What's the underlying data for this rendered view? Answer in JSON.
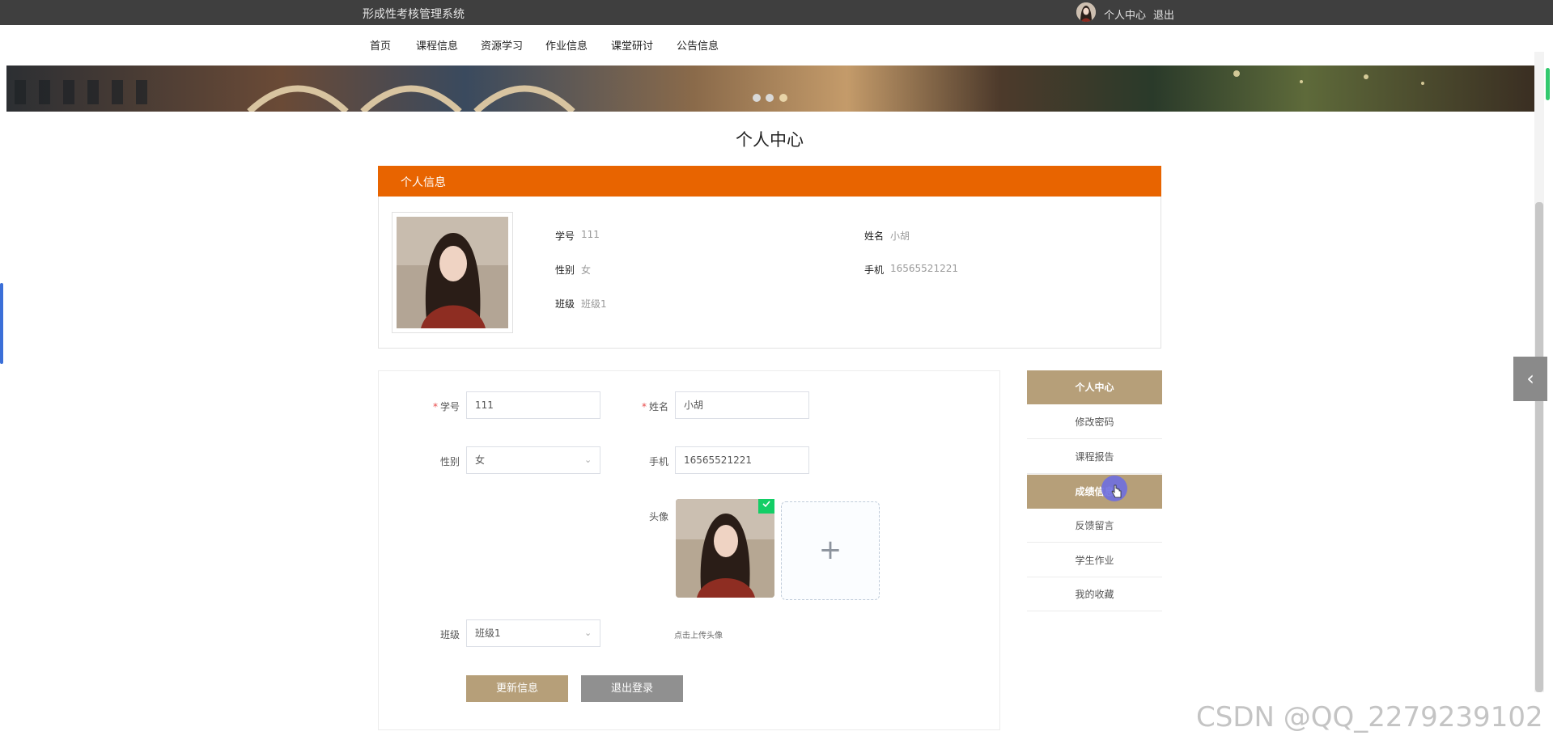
{
  "header": {
    "site_title": "形成性考核管理系统",
    "user_center": "个人中心",
    "logout": "退出"
  },
  "nav": {
    "items": [
      "首页",
      "课程信息",
      "资源学习",
      "作业信息",
      "课堂研讨",
      "公告信息"
    ]
  },
  "page": {
    "title": "个人中心"
  },
  "info_card": {
    "heading": "个人信息",
    "fields": {
      "student_id_label": "学号",
      "student_id_value": "111",
      "name_label": "姓名",
      "name_value": "小胡",
      "gender_label": "性别",
      "gender_value": "女",
      "phone_label": "手机",
      "phone_value": "16565521221",
      "class_label": "班级",
      "class_value": "班级1"
    }
  },
  "form": {
    "student_id_label": "学号",
    "student_id_value": "111",
    "name_label": "姓名",
    "name_value": "小胡",
    "gender_label": "性别",
    "gender_value": "女",
    "phone_label": "手机",
    "phone_value": "16565521221",
    "avatar_label": "头像",
    "upload_hint": "点击上传头像",
    "class_label": "班级",
    "class_value": "班级1",
    "update_button": "更新信息",
    "logout_button": "退出登录"
  },
  "side_menu": {
    "items": [
      "个人中心",
      "修改密码",
      "课程报告",
      "成绩信息",
      "反馈留言",
      "学生作业",
      "我的收藏"
    ],
    "active": [
      "个人中心",
      "成绩信息"
    ]
  },
  "watermark": "CSDN @QQ_2279239102",
  "colors": {
    "topbar": "#3f3f3f",
    "accent_orange": "#e86400",
    "accent_tan": "#b69f79",
    "logout_gray": "#909090"
  }
}
